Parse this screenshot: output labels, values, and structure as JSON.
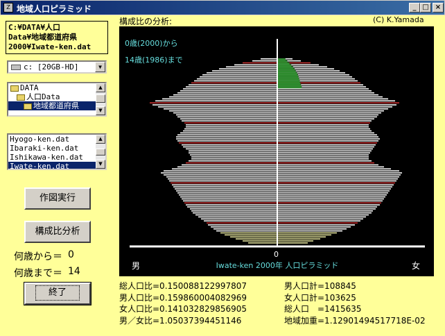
{
  "window": {
    "title": "地域人口ピラミッド",
    "icon": "Z"
  },
  "path_box": {
    "lines": [
      "C:¥DATA¥人口",
      "Data¥地域都道府県",
      "2000¥Iwate-ken.dat"
    ]
  },
  "drive": {
    "value": "c: [20GB-HD]"
  },
  "folders": [
    {
      "label": "DATA",
      "indent": 0,
      "selected": false
    },
    {
      "label": "人口Data",
      "indent": 1,
      "selected": false
    },
    {
      "label": "地域都道府県",
      "indent": 2,
      "selected": true
    }
  ],
  "files": [
    {
      "label": "Hyogo-ken.dat",
      "selected": false
    },
    {
      "label": "Ibaraki-ken.dat",
      "selected": false
    },
    {
      "label": "Ishikawa-ken.dat",
      "selected": false
    },
    {
      "label": "Iwate-ken.dat",
      "selected": true
    }
  ],
  "buttons": {
    "draw": "作図実行",
    "analyze": "構成比分析",
    "exit": "終了"
  },
  "age_from": {
    "label": "何歳から＝",
    "value": "0"
  },
  "age_to": {
    "label": "何歳まで＝",
    "value": "14"
  },
  "chart_header": {
    "title": "構成比の分析:",
    "author": "(C) K.Yamada"
  },
  "chart_data": {
    "type": "bar",
    "title": "Iwate-ken 2000年 人口ピラミッド",
    "subtitle_from": "0歳(2000)から",
    "subtitle_to": "14歳(1986)まで",
    "axis_zero": "0",
    "left_label": "男",
    "right_label": "女",
    "highlight_range": [
      0,
      14
    ],
    "male": [
      0.21,
      0.25,
      0.3,
      0.34,
      0.38,
      0.41,
      0.44,
      0.46,
      0.48,
      0.5,
      0.51,
      0.53,
      0.55,
      0.57,
      0.59,
      0.61,
      0.62,
      0.63,
      0.65,
      0.66,
      0.67,
      0.68,
      0.69,
      0.7,
      0.71,
      0.72,
      0.73,
      0.74,
      0.75,
      0.76,
      0.77,
      0.78,
      0.79,
      0.8,
      0.82,
      0.84,
      0.82,
      0.76,
      0.72,
      0.69,
      0.66,
      0.64,
      0.62,
      0.62,
      0.63,
      0.64,
      0.64,
      0.66,
      0.68,
      0.69,
      0.71,
      0.72,
      0.73,
      0.73,
      0.72,
      0.7,
      0.68,
      0.67,
      0.66,
      0.66,
      0.67,
      0.69,
      0.7,
      0.72,
      0.73,
      0.75,
      0.78,
      0.82,
      0.86,
      0.9,
      0.92,
      0.88,
      0.83,
      0.78,
      0.75,
      0.72,
      0.7,
      0.68,
      0.66,
      0.64,
      0.62,
      0.6,
      0.58,
      0.56,
      0.54,
      0.51,
      0.47,
      0.42,
      0.37,
      0.31,
      0.25,
      0.18,
      0.12
    ],
    "female": [
      0.22,
      0.26,
      0.31,
      0.35,
      0.39,
      0.43,
      0.47,
      0.5,
      0.53,
      0.56,
      0.58,
      0.6,
      0.62,
      0.64,
      0.66,
      0.68,
      0.69,
      0.71,
      0.72,
      0.74,
      0.75,
      0.76,
      0.77,
      0.78,
      0.79,
      0.8,
      0.81,
      0.82,
      0.83,
      0.84,
      0.85,
      0.86,
      0.87,
      0.88,
      0.89,
      0.9,
      0.88,
      0.82,
      0.77,
      0.73,
      0.7,
      0.68,
      0.66,
      0.66,
      0.66,
      0.67,
      0.68,
      0.69,
      0.7,
      0.71,
      0.72,
      0.73,
      0.74,
      0.73,
      0.72,
      0.7,
      0.68,
      0.67,
      0.66,
      0.66,
      0.67,
      0.68,
      0.7,
      0.72,
      0.73,
      0.75,
      0.77,
      0.8,
      0.83,
      0.86,
      0.88,
      0.85,
      0.8,
      0.76,
      0.73,
      0.7,
      0.68,
      0.66,
      0.64,
      0.62,
      0.6,
      0.58,
      0.56,
      0.54,
      0.52,
      0.49,
      0.45,
      0.41,
      0.36,
      0.3,
      0.24,
      0.17,
      0.11
    ],
    "colors": {
      "background": "#000000",
      "bar_male": "#ffffff",
      "bar_female": "#ffffff",
      "highlight": "#2e8b2e",
      "accent": "#cc3333",
      "old": "#e8e8a0",
      "axis": "#ffffff",
      "label": "#66dddd"
    }
  },
  "stats_left": [
    "総人口比=0.150088122997807",
    "男人口比=0.159860004082969",
    "女人口比=0.141032829856905",
    "男／女比=1.05037394451146"
  ],
  "stats_right": [
    "男人口計=108845",
    "女人口計=103625",
    "総人口　=1415635",
    "地域加重=1.12901494517718E-02"
  ]
}
